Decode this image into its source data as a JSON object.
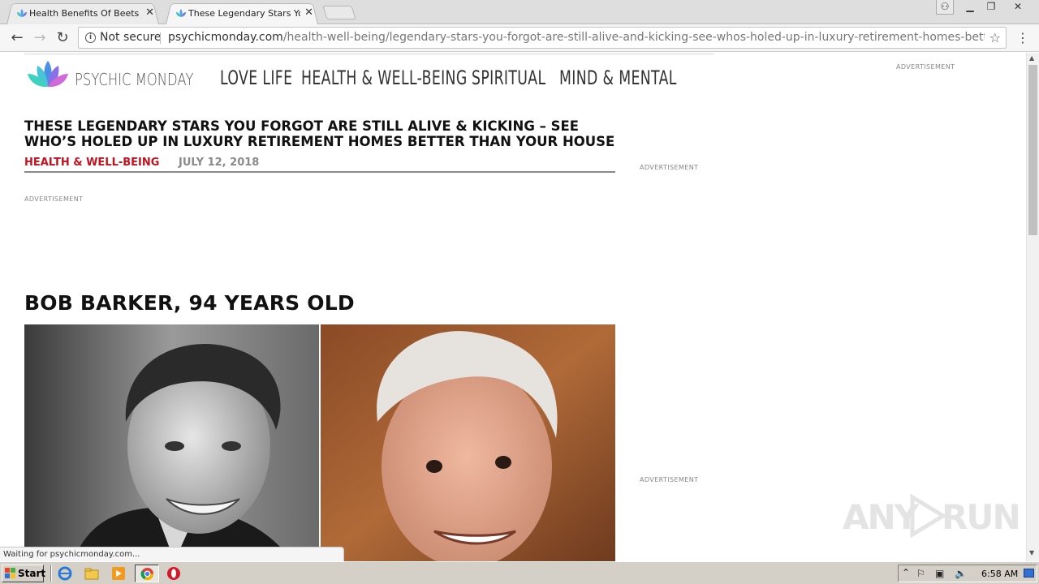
{
  "browser": {
    "tabs": [
      {
        "title": "Health Benefits Of Beets Yo",
        "active": false
      },
      {
        "title": "These Legendary Stars You",
        "active": true
      }
    ],
    "close_glyph": "✕",
    "window_controls": {
      "user": "⚇",
      "minimize": "▁",
      "restore": "❐",
      "close": "✕"
    },
    "nav": {
      "back": "←",
      "forward": "→",
      "reload": "↻"
    },
    "omnibox": {
      "security_label": "Not secure",
      "domain": "psychicmonday.com",
      "path": "/health-well-being/legendary-stars-you-forgot-are-still-alive-and-kicking-see-whos-holed-up-in-luxury-retirement-homes-better-than-your-hou..."
    },
    "bookmark_icon": "☆",
    "menu_icon": "⋮",
    "status_text": "Waiting for psychicmonday.com..."
  },
  "site": {
    "logo_text": "PSYCHIC MONDAY",
    "nav": [
      "LOVE LIFE",
      "HEALTH & WELL-BEING",
      "SPIRITUAL",
      "MIND & MENTAL"
    ],
    "accent_color": "#c1121f"
  },
  "article": {
    "headline": "THESE LEGENDARY STARS YOU FORGOT ARE STILL ALIVE & KICKING – SEE WHO’S HOLED UP IN LUXURY RETIREMENT HOMES BETTER THAN YOUR HOUSE",
    "category": "HEALTH & WELL-BEING",
    "date": "JULY 12, 2018",
    "section_title": "BOB BARKER, 94 YEARS OLD"
  },
  "ads": {
    "label": "ADVERTISEMENT"
  },
  "watermark": {
    "text_left": "ANY",
    "text_right": "RUN"
  },
  "taskbar": {
    "start_label": "Start",
    "clock": "6:58 AM"
  }
}
